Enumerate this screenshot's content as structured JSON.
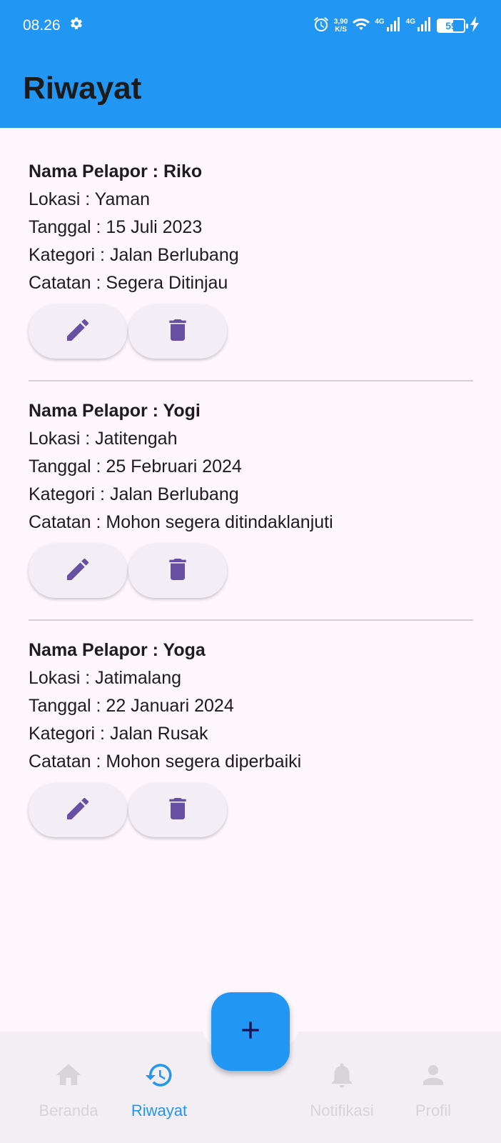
{
  "status_bar": {
    "time": "08.26",
    "speed_value": "3,90",
    "speed_unit": "K/S",
    "network_1": "4G",
    "network_2": "4G",
    "battery": "59"
  },
  "app_bar": {
    "title": "Riwayat"
  },
  "reports": [
    {
      "name": "Nama Pelapor : Riko",
      "location": "Lokasi : Yaman",
      "date": "Tanggal : 15 Juli 2023",
      "category": "Kategori : Jalan Berlubang",
      "note": "Catatan : Segera Ditinjau"
    },
    {
      "name": "Nama Pelapor : Yogi",
      "location": "Lokasi : Jatitengah",
      "date": "Tanggal : 25 Februari 2024",
      "category": "Kategori : Jalan Berlubang",
      "note": "Catatan : Mohon segera ditindaklanjuti"
    },
    {
      "name": "Nama Pelapor : Yoga",
      "location": "Lokasi : Jatimalang",
      "date": "Tanggal : 22 Januari 2024",
      "category": "Kategori : Jalan Rusak",
      "note": "Catatan : Mohon segera diperbaiki"
    }
  ],
  "bottom_nav": {
    "items": [
      {
        "label": "Beranda",
        "icon": "home-icon",
        "active": false
      },
      {
        "label": "Riwayat",
        "icon": "history-icon",
        "active": true
      },
      {
        "label": "Notifikasi",
        "icon": "bell-icon",
        "active": false
      },
      {
        "label": "Profil",
        "icon": "person-icon",
        "active": false
      }
    ]
  },
  "fab": {
    "icon": "plus-icon"
  },
  "colors": {
    "primary": "#2196f3",
    "action_icon": "#6750a4",
    "background": "#fdf7fd",
    "nav_inactive": "#d7d3d9"
  }
}
